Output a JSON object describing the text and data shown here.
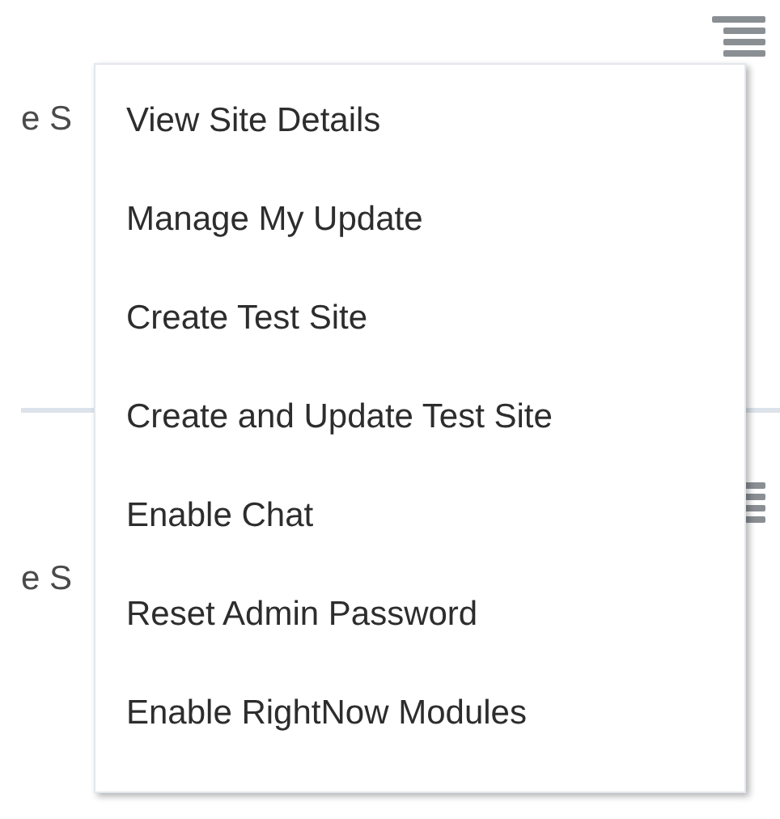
{
  "panels": [
    {
      "label": "e S"
    },
    {
      "label": "e S"
    }
  ],
  "menu": {
    "items": [
      {
        "label": "View Site Details"
      },
      {
        "label": "Manage My Update"
      },
      {
        "label": "Create Test Site"
      },
      {
        "label": "Create and Update Test Site"
      },
      {
        "label": "Enable Chat"
      },
      {
        "label": "Reset Admin Password"
      },
      {
        "label": "Enable RightNow Modules"
      }
    ]
  }
}
